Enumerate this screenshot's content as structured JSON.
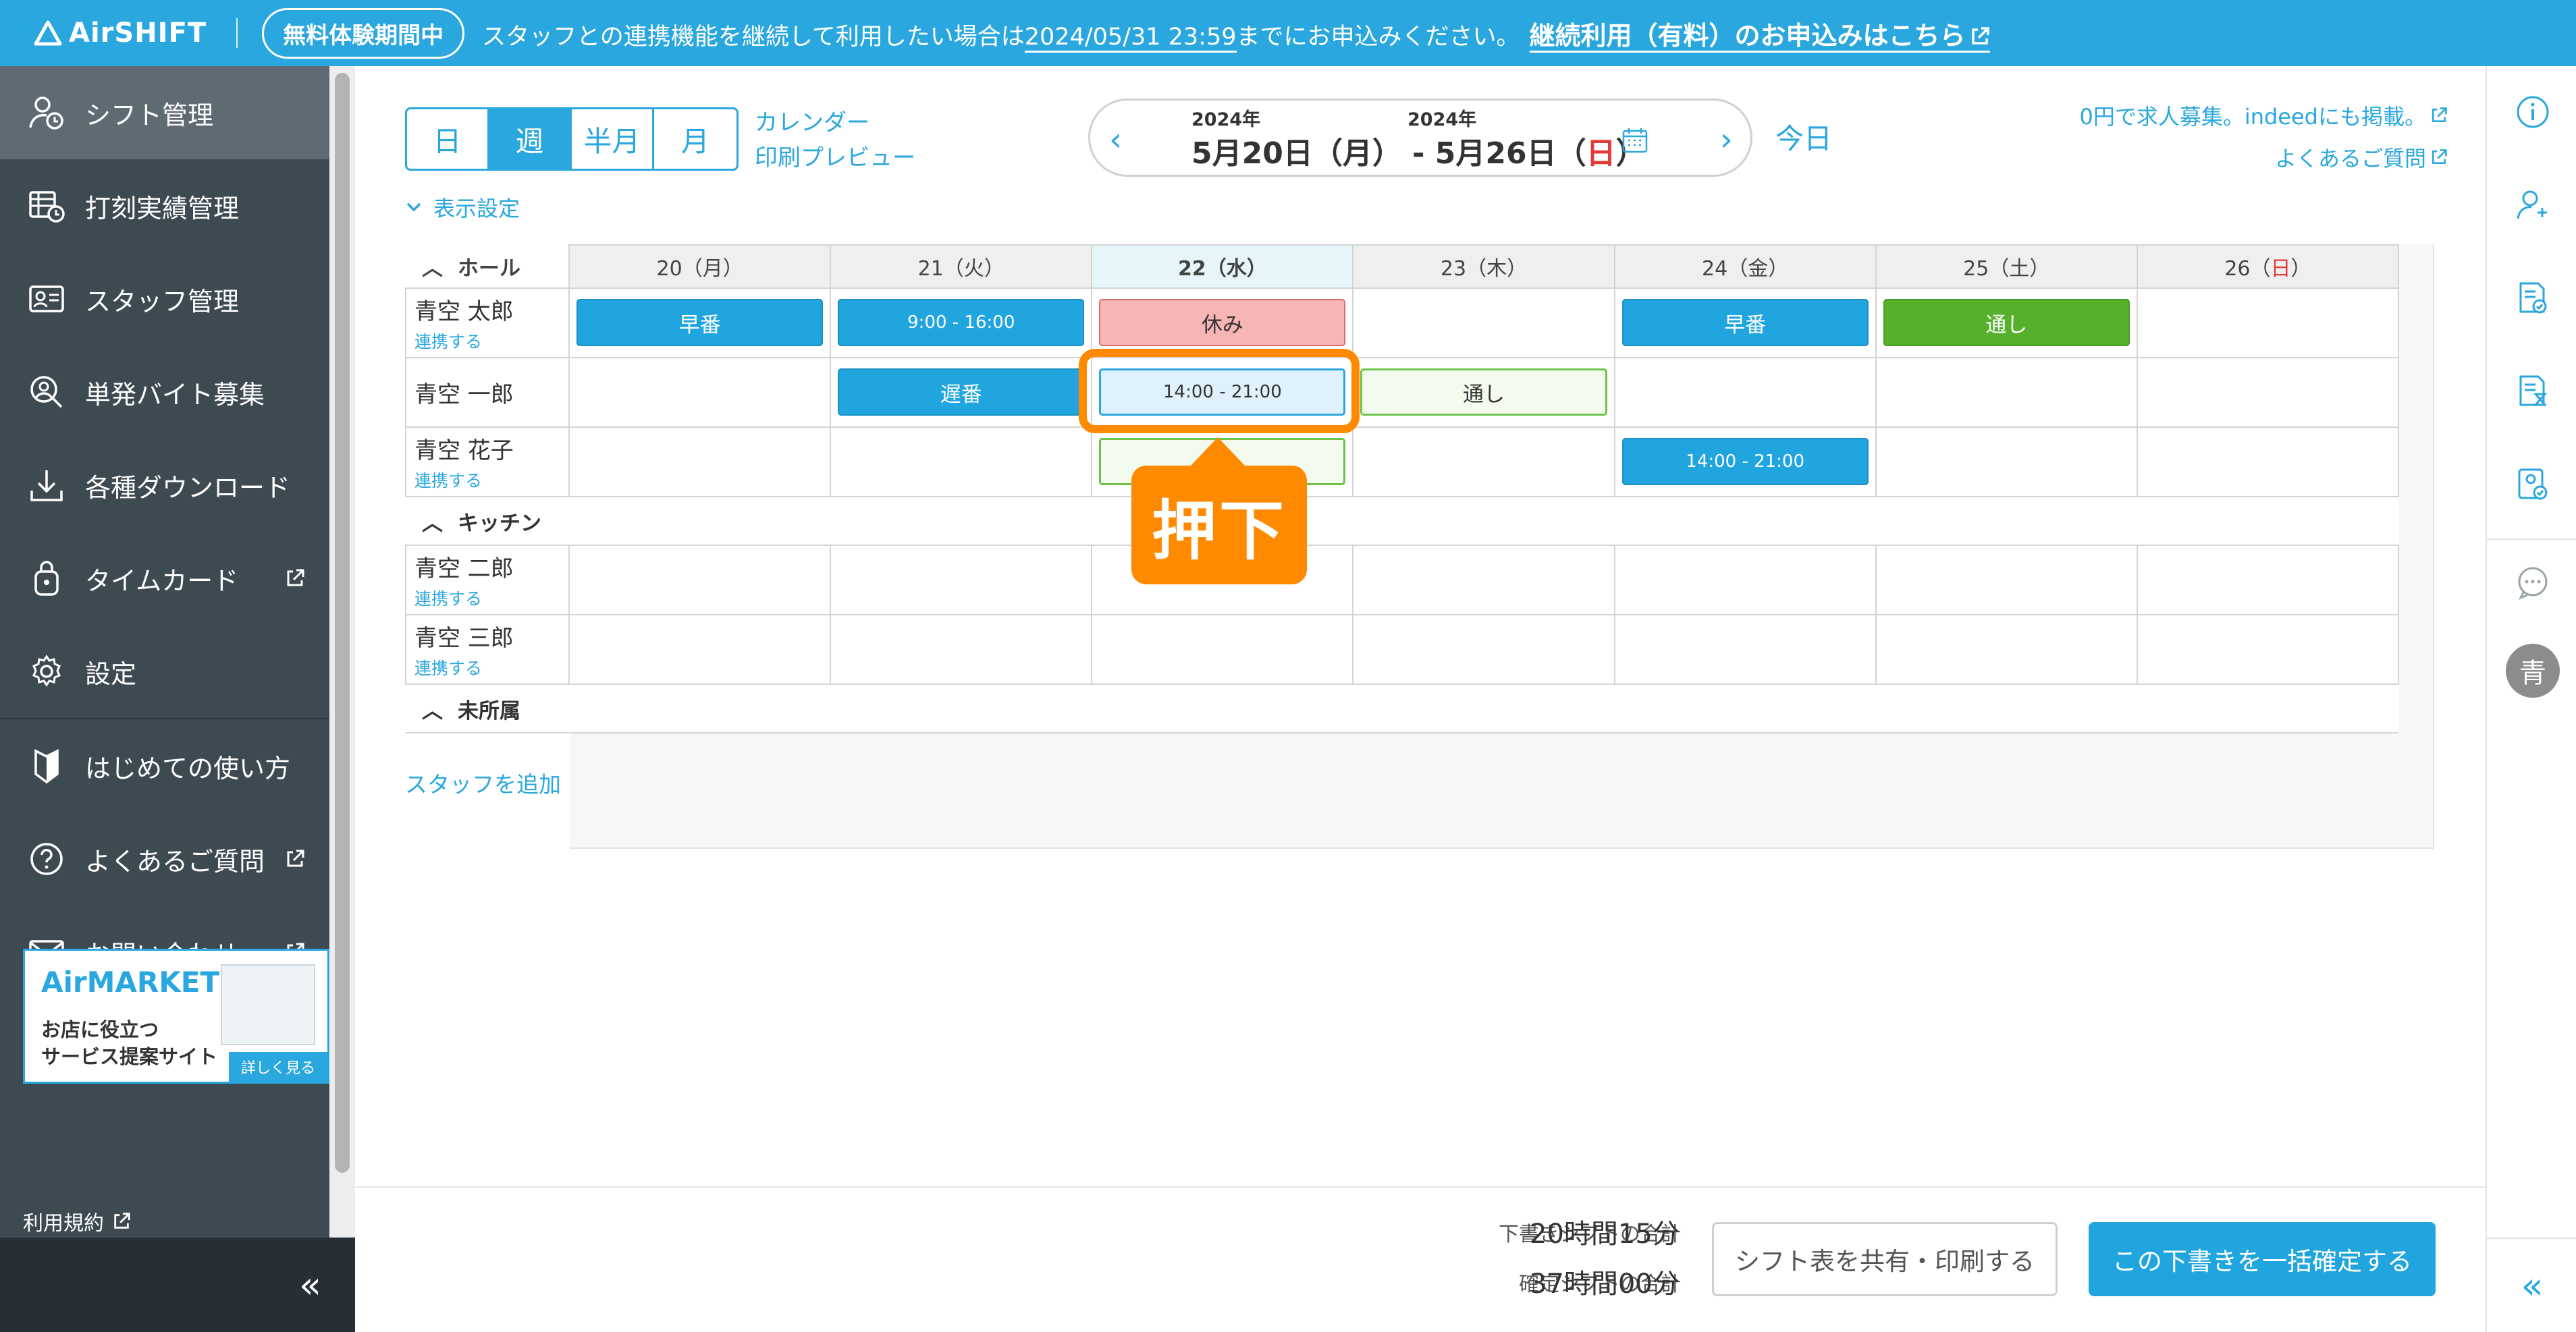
{
  "topbar": {
    "logo": "AirSHIFT",
    "trial_badge": "無料体験期間中",
    "notice_pre": "スタッフとの連携機能を継続して利用したい場合は",
    "notice_deadline": "2024/05/31 23:59",
    "notice_post": "までにお申込みください。",
    "notice_cta": "継続利用（有料）のお申込みはこちら"
  },
  "sidebar": {
    "items": [
      {
        "label": "シフト管理",
        "icon": "staff-shift-icon",
        "active": true
      },
      {
        "label": "打刻実績管理",
        "icon": "clock-record-icon"
      },
      {
        "label": "スタッフ管理",
        "icon": "staff-card-icon"
      },
      {
        "label": "単発バイト募集",
        "icon": "search-person-icon"
      },
      {
        "label": "各種ダウンロード",
        "icon": "download-icon"
      },
      {
        "label": "タイムカード",
        "icon": "timecard-icon",
        "external": true
      },
      {
        "label": "設定",
        "icon": "gear-icon"
      },
      {
        "label": "はじめての使い方",
        "icon": "beginner-icon"
      },
      {
        "label": "よくあるご質問",
        "icon": "question-icon",
        "external": true
      },
      {
        "label": "お問い合わせ",
        "icon": "mail-icon",
        "external": true
      }
    ],
    "ad": {
      "brand": "AirMARKET",
      "line1": "お店に役立つ",
      "line2": "サービス提案サイト",
      "more": "詳しく見る"
    },
    "terms": "利用規約",
    "collapse": "«"
  },
  "toolbar": {
    "view_tabs": [
      "日",
      "週",
      "半月",
      "月"
    ],
    "active_tab": "週",
    "calendar_link": "カレンダー",
    "print_link": "印刷プレビュー",
    "date_start_year": "2024年",
    "date_end_year": "2024年",
    "date_range_main": "5月20日（月） - 5月26日（",
    "date_range_sun": "日",
    "date_range_end": "）",
    "today": "今日",
    "recruit_link": "0円で求人募集。indeedにも掲載。",
    "faq_link": "よくあるご質問",
    "display_settings": "表示設定"
  },
  "grid": {
    "days": [
      "20（月）",
      "21（火）",
      "22（水）",
      "23（木）",
      "24（金）",
      "25（土）"
    ],
    "sunday_day": "26（",
    "sunday_mark": "日",
    "sunday_close": "）",
    "today_index": 2,
    "groups": [
      {
        "name": "ホール"
      },
      {
        "name": "キッチン"
      },
      {
        "name": "未所属"
      }
    ],
    "staff": [
      {
        "name": "青空 太郎",
        "link": "連携する",
        "shifts": [
          "早番",
          "9:00 - 16:00",
          "休み",
          "",
          "早番",
          "通し",
          ""
        ]
      },
      {
        "name": "青空 一郎",
        "link": "",
        "shifts": [
          "",
          "遅番",
          "14:00 - 21:00",
          "通し",
          "",
          "",
          ""
        ]
      },
      {
        "name": "青空 花子",
        "link": "連携する",
        "shifts": [
          "",
          "",
          "",
          "",
          "14:00 - 21:00",
          "",
          ""
        ]
      },
      {
        "name": "青空 二郎",
        "link": "連携する",
        "shifts": [
          "",
          "",
          "",
          "",
          "",
          "",
          ""
        ]
      },
      {
        "name": "青空 三郎",
        "link": "連携する",
        "shifts": [
          "",
          "",
          "",
          "",
          "",
          "",
          ""
        ]
      }
    ],
    "add_staff": "スタッフを追加"
  },
  "annotation": {
    "callout": "押下",
    "color": "#ff8a00"
  },
  "footer": {
    "draft_label": "下書きシフトの合計",
    "draft_value": "20時間15分",
    "confirmed_label": "確定シフトの合計",
    "confirmed_value": "37時間00分",
    "share_button": "シフト表を共有・印刷する",
    "confirm_button": "この下書きを一括確定する"
  },
  "rightbar": {
    "avatar": "青",
    "collapse": "«"
  },
  "colors": {
    "brand": "#2aa7df",
    "sidebar": "#3d4a52",
    "green": "#56b02c",
    "holiday_red": "#e53935"
  }
}
